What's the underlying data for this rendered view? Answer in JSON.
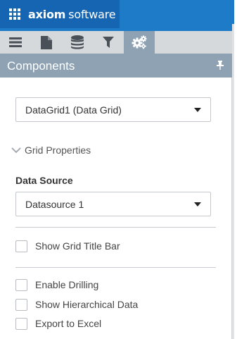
{
  "app": {
    "brand_strong": "axiom",
    "brand_light": "software"
  },
  "toolbar": {
    "buttons": [
      {
        "icon": "menu-icon",
        "active": false
      },
      {
        "icon": "document-icon",
        "active": false
      },
      {
        "icon": "database-icon",
        "active": false
      },
      {
        "icon": "filter-icon",
        "active": false
      },
      {
        "icon": "gears-icon",
        "active": true
      }
    ]
  },
  "panel": {
    "title": "Components",
    "component_select": {
      "value": "DataGrid1 (Data Grid)"
    },
    "section": {
      "label": "Grid Properties",
      "expanded": true
    },
    "data_source": {
      "label": "Data Source",
      "value": "Datasource 1"
    },
    "options": [
      {
        "label": "Show Grid Title Bar",
        "checked": false
      },
      {
        "label": "Enable Drilling",
        "checked": false
      },
      {
        "label": "Show Hierarchical Data",
        "checked": false
      },
      {
        "label": "Export to Excel",
        "checked": false
      }
    ]
  },
  "colors": {
    "header_blue": "#1e7bc8",
    "logo_blue": "#1565b2",
    "toolbar_gray": "#d6d9dc",
    "panel_header": "#8ea2b3"
  }
}
